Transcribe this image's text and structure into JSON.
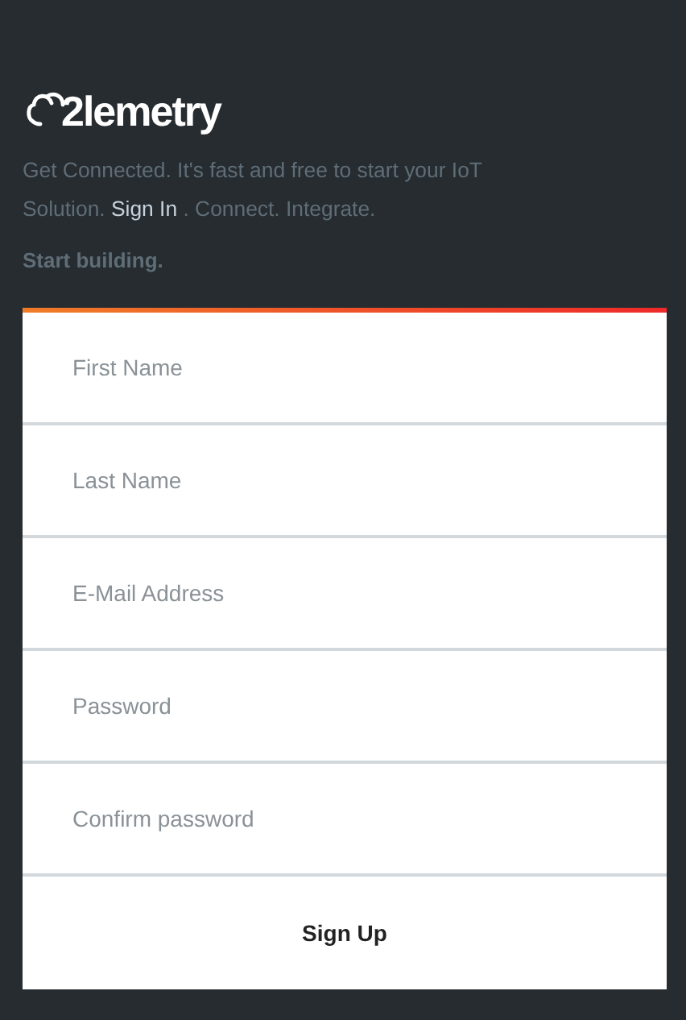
{
  "logo": {
    "text": "2lemetry"
  },
  "intro": {
    "before": "Get Connected. It's fast and free to start your IoT Solution. ",
    "link": "Sign In",
    "after": " . Connect. Integrate."
  },
  "tagline": "Start building.",
  "fields": [
    {
      "placeholder": "First Name"
    },
    {
      "placeholder": "Last Name"
    },
    {
      "placeholder": "E-Mail Address"
    },
    {
      "placeholder": "Password"
    },
    {
      "placeholder": "Confirm password"
    }
  ],
  "submit": "Sign Up"
}
